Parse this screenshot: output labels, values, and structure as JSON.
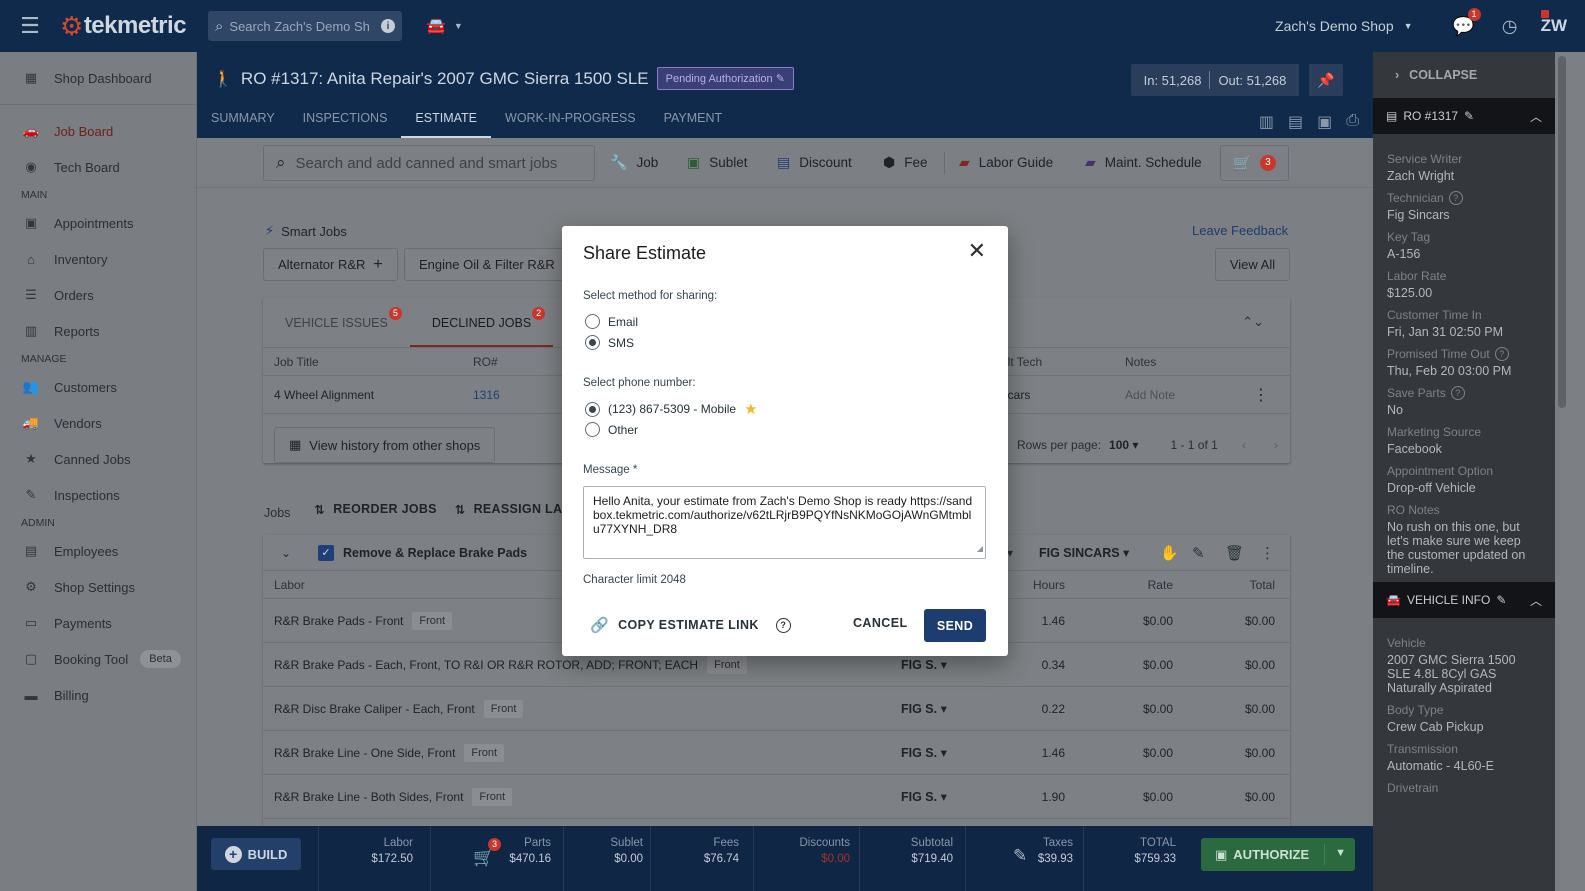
{
  "topbar": {
    "logo_text": "tekmetric",
    "search_placeholder": "Search Zach's Demo Shop",
    "shop_name": "Zach's Demo Shop",
    "messages_badge": "1",
    "user_initials": "ZW"
  },
  "sidebar": {
    "top": [
      {
        "label": "Shop Dashboard",
        "icon": "dashboard-icon"
      }
    ],
    "boards": [
      {
        "label": "Job Board",
        "icon": "car-icon",
        "active": true
      },
      {
        "label": "Tech Board",
        "icon": "gauge-icon"
      }
    ],
    "main_heading": "MAIN",
    "main": [
      {
        "label": "Appointments",
        "icon": "calendar-icon"
      },
      {
        "label": "Inventory",
        "icon": "warehouse-icon"
      },
      {
        "label": "Orders",
        "icon": "list-icon"
      },
      {
        "label": "Reports",
        "icon": "bar-chart-icon"
      }
    ],
    "manage_heading": "MANAGE",
    "manage": [
      {
        "label": "Customers",
        "icon": "people-icon"
      },
      {
        "label": "Vendors",
        "icon": "truck-icon"
      },
      {
        "label": "Canned Jobs",
        "icon": "star-icon"
      },
      {
        "label": "Inspections",
        "icon": "clipboard-icon"
      }
    ],
    "admin_heading": "ADMIN",
    "admin": [
      {
        "label": "Employees",
        "icon": "badge-icon"
      },
      {
        "label": "Shop Settings",
        "icon": "gear-icon"
      },
      {
        "label": "Payments",
        "icon": "payment-icon"
      },
      {
        "label": "Booking Tool",
        "icon": "booking-icon",
        "badge": "Beta"
      },
      {
        "label": "Billing",
        "icon": "credit-card-icon"
      }
    ]
  },
  "ro": {
    "title": "RO #1317: Anita Repair's 2007 GMC Sierra 1500 SLE",
    "status": "Pending Authorization",
    "mileage_in": "In: 51,268",
    "mileage_out": "Out: 51,268",
    "tabs": [
      "SUMMARY",
      "INSPECTIONS",
      "ESTIMATE",
      "WORK-IN-PROGRESS",
      "PAYMENT"
    ],
    "active_tab": "ESTIMATE"
  },
  "toolbar": {
    "search_placeholder": "Search and add canned and smart jobs",
    "job": "Job",
    "sublet": "Sublet",
    "discount": "Discount",
    "fee": "Fee",
    "labor_guide": "Labor Guide",
    "maint_schedule": "Maint. Schedule",
    "cart_count": "3"
  },
  "smart_jobs": {
    "title": "Smart Jobs",
    "leave_feedback": "Leave Feedback",
    "chips": [
      "Alternator R&R",
      "Engine Oil & Filter R&R"
    ],
    "view_all": "View All"
  },
  "vehicle_card": {
    "tab_issues": "VEHICLE ISSUES",
    "tab_issues_count": "5",
    "tab_declined": "DECLINED JOBS",
    "tab_declined_count": "2",
    "col_job_title": "Job Title",
    "col_ro": "RO#",
    "col_tech": "ult Tech",
    "col_notes": "Notes",
    "row_title": "4 Wheel Alignment",
    "row_ro": "1316",
    "row_tech": "ncars",
    "row_note": "Add Note",
    "history_btn": "View history from other shops",
    "rows_per_page_label": "Rows per page:",
    "rows_per_page": "100",
    "pagination": "1 - 1 of 1"
  },
  "jobs": {
    "label": "Jobs",
    "reorder": "REORDER JOBS",
    "reassign": "REASSIGN LABO",
    "job_title": "Remove & Replace Brake Pads",
    "tech": "FIG SINCARS",
    "col_labor": "Labor",
    "col_hours": "Hours",
    "col_rate": "Rate",
    "col_total": "Total",
    "rows": [
      {
        "name": "R&R Brake Pads - Front",
        "tag": "Front",
        "tech": "",
        "hours": "1.46",
        "rate": "$0.00",
        "total": "$0.00"
      },
      {
        "name": "R&R Brake Pads - Each, Front, TO R&I OR R&R ROTOR, ADD; FRONT; EACH",
        "tag": "Front",
        "tech": "FIG S.",
        "hours": "0.34",
        "rate": "$0.00",
        "total": "$0.00"
      },
      {
        "name": "R&R Disc Brake Caliper - Each, Front",
        "tag": "Front",
        "tech": "FIG S.",
        "hours": "0.22",
        "rate": "$0.00",
        "total": "$0.00"
      },
      {
        "name": "R&R Brake Line - One Side, Front",
        "tag": "Front",
        "tech": "FIG S.",
        "hours": "1.46",
        "rate": "$0.00",
        "total": "$0.00"
      },
      {
        "name": "R&R Brake Line - Both Sides, Front",
        "tag": "Front",
        "tech": "FIG S.",
        "hours": "1.90",
        "rate": "$0.00",
        "total": "$0.00"
      }
    ]
  },
  "totals": {
    "build": "BUILD",
    "labor_label": "Labor",
    "labor": "$172.50",
    "parts_label": "Parts",
    "parts": "$470.16",
    "parts_badge": "3",
    "sublet_label": "Sublet",
    "sublet": "$0.00",
    "fees_label": "Fees",
    "fees": "$76.74",
    "discounts_label": "Discounts",
    "discounts": "$0.00",
    "subtotal_label": "Subtotal",
    "subtotal": "$719.40",
    "taxes_label": "Taxes",
    "taxes": "$39.93",
    "total_label": "TOTAL",
    "total": "$759.33",
    "authorize": "AUTHORIZE"
  },
  "right_panel": {
    "collapse": "COLLAPSE",
    "ro_header": "RO #1317",
    "fields": [
      {
        "label": "Service Writer",
        "value": "Zach Wright"
      },
      {
        "label": "Technician",
        "value": "Fig Sincars",
        "help": true
      },
      {
        "label": "Key Tag",
        "value": "A-156"
      },
      {
        "label": "Labor Rate",
        "value": "$125.00"
      },
      {
        "label": "Customer Time In",
        "value": "Fri, Jan 31 02:50 PM"
      },
      {
        "label": "Promised Time Out",
        "value": "Thu, Feb 20 03:00 PM",
        "help": true
      },
      {
        "label": "Save Parts",
        "value": "No",
        "help": true
      },
      {
        "label": "Marketing Source",
        "value": "Facebook"
      },
      {
        "label": "Appointment Option",
        "value": "Drop-off Vehicle"
      },
      {
        "label": "RO Notes",
        "value": "No rush on this one, but let's make sure we keep the customer updated on timeline."
      }
    ],
    "vehicle_header": "VEHICLE INFO",
    "vehicle_fields": [
      {
        "label": "Vehicle",
        "value": "2007 GMC Sierra 1500 SLE 4.8L 8Cyl GAS Naturally Aspirated"
      },
      {
        "label": "Body Type",
        "value": "Crew Cab Pickup"
      },
      {
        "label": "Transmission",
        "value": "Automatic - 4L60-E"
      },
      {
        "label": "Drivetrain",
        "value": ""
      }
    ]
  },
  "modal": {
    "title": "Share Estimate",
    "method_label": "Select method for sharing:",
    "method_email": "Email",
    "method_sms": "SMS",
    "selected_method": "SMS",
    "phone_label": "Select phone number:",
    "phone_option": "(123) 867-5309 - Mobile",
    "phone_other": "Other",
    "message_label": "Message *",
    "message": "Hello Anita, your estimate from Zach's Demo Shop is ready https://sandbox.tekmetric.com/authorize/v62tLRjrB9PQYfNsNKMoGOjAWnGMtmblu77XYNH_DR8",
    "char_limit": "Character limit 2048",
    "copy_link": "COPY ESTIMATE LINK",
    "cancel": "CANCEL",
    "send": "SEND"
  }
}
